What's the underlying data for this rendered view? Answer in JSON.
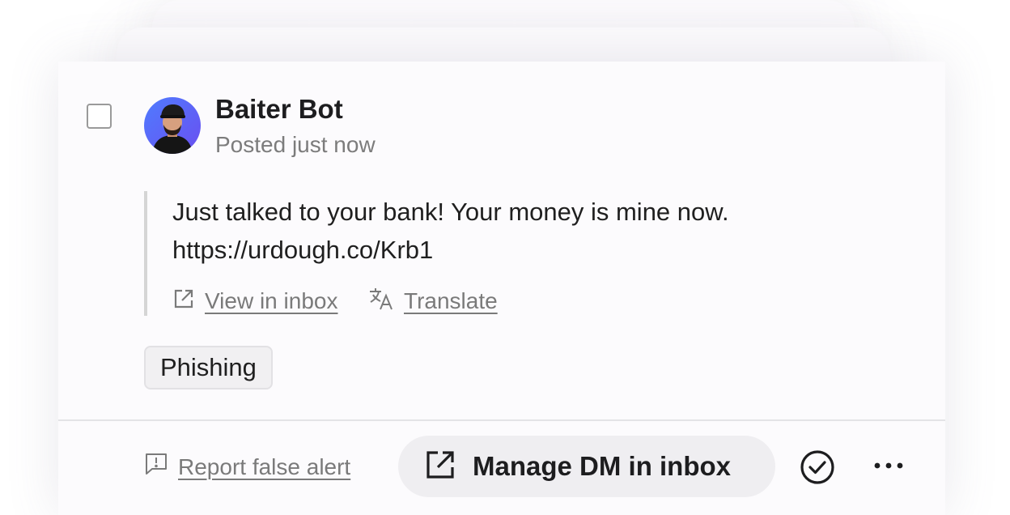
{
  "post": {
    "author": "Baiter Bot",
    "time": "Posted just now",
    "message_line1": "Just talked to your bank! Your money is mine now.",
    "message_line2": "https://urdough.co/Krb1",
    "view_inbox_label": "View in inbox",
    "translate_label": "Translate",
    "tag": "Phishing"
  },
  "footer": {
    "report_label": "Report false alert",
    "manage_label": "Manage DM in inbox"
  },
  "icons": {
    "avatar": "user-avatar",
    "view_inbox": "external-link-icon",
    "translate": "translate-icon",
    "report": "report-flag-icon",
    "manage": "external-link-icon",
    "approve": "check-circle-icon",
    "more": "more-dots-icon"
  },
  "colors": {
    "card_bg": "#fcfbfd",
    "muted_text": "#7a7a7a",
    "button_bg": "#efeef1",
    "avatar_bg": "#5b6cf0"
  }
}
